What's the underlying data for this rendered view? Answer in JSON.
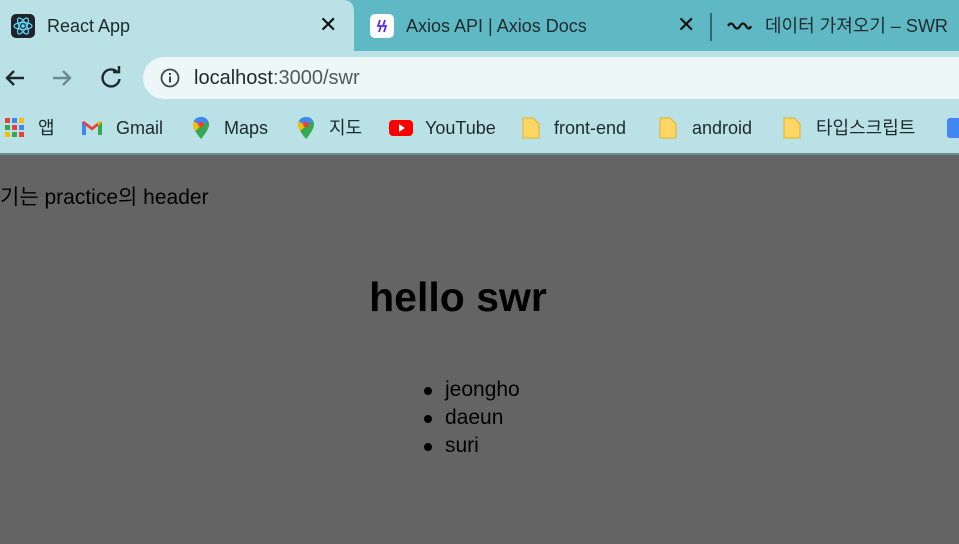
{
  "tabs": [
    {
      "title": "React App",
      "icon": "react-icon",
      "close": "✕",
      "active": true
    },
    {
      "title": "Axios API | Axios Docs",
      "icon": "axios-icon",
      "close": "✕",
      "active": false
    },
    {
      "title": "데이터 가져오기 – SWR",
      "icon": "swr-icon",
      "active": false
    }
  ],
  "address_bar": {
    "host": "localhost",
    "path": ":3000/swr"
  },
  "bookmarks": [
    {
      "label": "앱",
      "icon": "apps-grid-icon"
    },
    {
      "label": "Gmail",
      "icon": "gmail-icon"
    },
    {
      "label": "Maps",
      "icon": "maps-pin-icon"
    },
    {
      "label": "지도",
      "icon": "maps-pin-icon"
    },
    {
      "label": "YouTube",
      "icon": "youtube-icon"
    },
    {
      "label": "front-end",
      "icon": "folder-icon"
    },
    {
      "label": "android",
      "icon": "folder-icon"
    },
    {
      "label": "타입스크립트",
      "icon": "folder-icon"
    }
  ],
  "page": {
    "header_text": "기는 practice의 header",
    "title": "hello swr",
    "users": [
      "jeongho",
      "daeun",
      "suri"
    ]
  },
  "colors": {
    "tabstrip": "#5fb9c4",
    "toolbar": "#b9e1e6",
    "page_background": "#646464"
  }
}
